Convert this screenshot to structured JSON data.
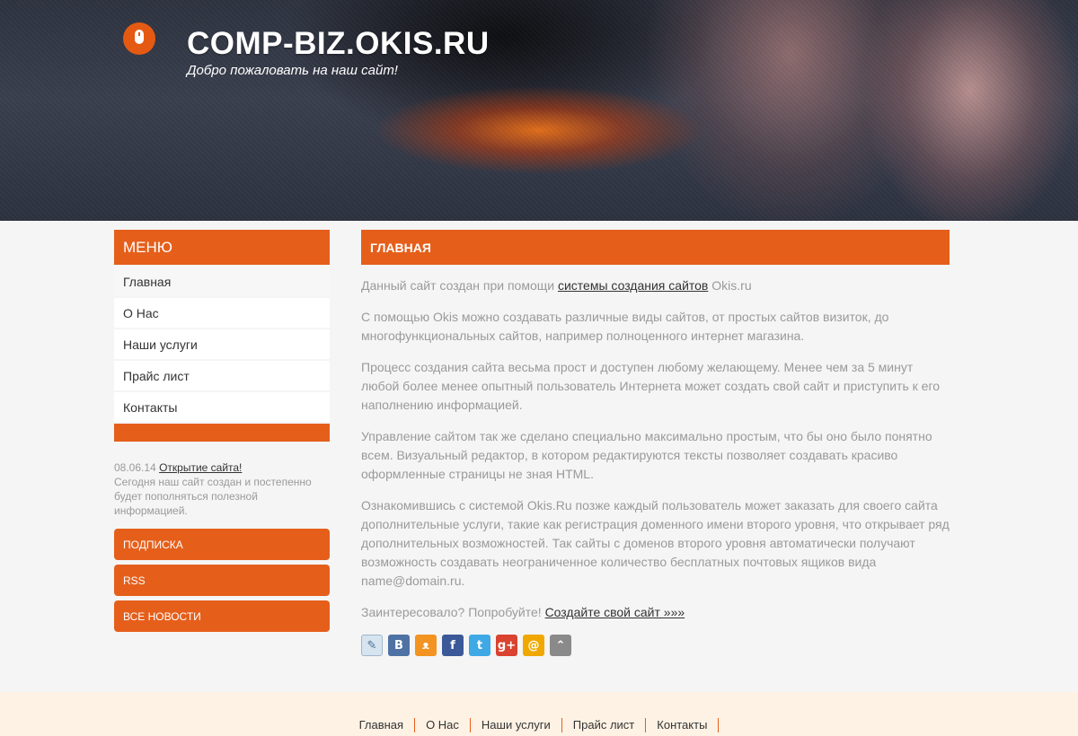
{
  "header": {
    "title": "COMP-BIZ.OKIS.RU",
    "tagline": "Добро пожаловать на наш сайт!"
  },
  "sidebar": {
    "menu_title": "МЕНЮ",
    "items": [
      {
        "label": "Главная"
      },
      {
        "label": "О Нас"
      },
      {
        "label": "Наши услуги"
      },
      {
        "label": "Прайс лист"
      },
      {
        "label": "Контакты"
      }
    ],
    "news": {
      "date": "08.06.14",
      "link": "Открытие сайта!",
      "text": "Сегодня наш сайт создан и постепенно будет пополняться полезной информацией."
    },
    "buttons": [
      {
        "label": "ПОДПИСКА"
      },
      {
        "label": "RSS"
      },
      {
        "label": "ВСЕ НОВОСТИ"
      }
    ]
  },
  "main": {
    "title": "ГЛАВНАЯ",
    "p1_before": "Данный сайт создан при помощи ",
    "p1_link": "системы создания сайтов",
    "p1_after": " Okis.ru",
    "p2": "С помощью Okis можно создавать различные виды сайтов, от простых сайтов визиток, до многофункциональных сайтов, например полноценного интернет магазина.",
    "p3": "Процесс создания сайта весьма прост и доступен любому желающему. Менее чем за 5 минут любой более менее опытный пользователь Интернета может создать свой сайт и приступить к его наполнению информацией.",
    "p4": "Управление сайтом так же сделано специально максимально простым, что бы оно было понятно всем. Визуальный редактор, в котором редактируются тексты позволяет создавать красиво оформленные страницы не зная HTML.",
    "p5": "Ознакомившись с системой Okis.Ru позже каждый пользователь может заказать для своего сайта дополнительные услуги, такие как регистрация доменного имени второго уровня, что открывает ряд дополнительных возможностей. Так сайты с доменов второго уровня автоматически получают возможность создавать неограниченное количество бесплатных почтовых ящиков вида name@domain.ru.",
    "p6_before": "Заинтересовало? Попробуйте! ",
    "p6_link": "Создайте свой сайт »»»",
    "social": [
      {
        "icon": "livejournal-icon",
        "glyph": "✎",
        "color": "#d6e4f0"
      },
      {
        "icon": "vkontakte-icon",
        "glyph": "B",
        "color": "#4e72a3"
      },
      {
        "icon": "odnoklassniki-icon",
        "glyph": "ᴥ",
        "color": "#f39321"
      },
      {
        "icon": "facebook-icon",
        "glyph": "f",
        "color": "#3b5998"
      },
      {
        "icon": "twitter-icon",
        "glyph": "t",
        "color": "#3fa9e6"
      },
      {
        "icon": "googleplus-icon",
        "glyph": "g+",
        "color": "#d9432f"
      },
      {
        "icon": "mailru-icon",
        "glyph": "@",
        "color": "#f0a800"
      },
      {
        "icon": "share-icon",
        "glyph": "⌃",
        "color": "#8a8a8a"
      }
    ]
  },
  "footer": {
    "items": [
      {
        "label": "Главная"
      },
      {
        "label": "О Нас"
      },
      {
        "label": "Наши услуги"
      },
      {
        "label": "Прайс лист"
      },
      {
        "label": "Контакты"
      }
    ]
  }
}
